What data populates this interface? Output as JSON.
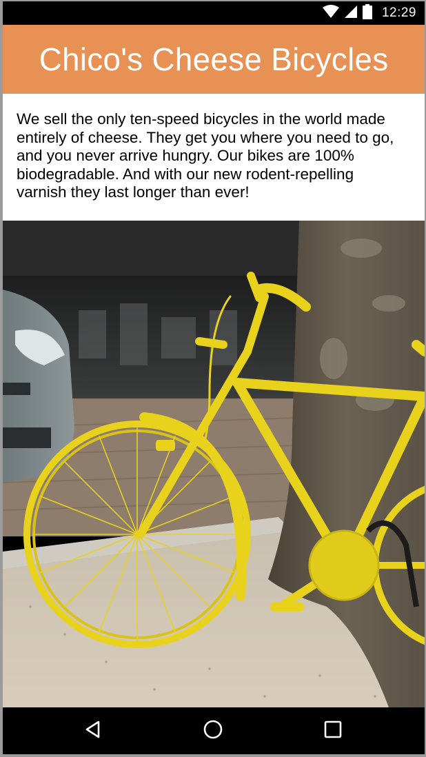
{
  "status_bar": {
    "time": "12:29",
    "icons": [
      "wifi-icon",
      "cell-signal-icon",
      "battery-icon"
    ]
  },
  "header": {
    "title": "Chico's Cheese Bicycles",
    "background_color": "#e89154",
    "text_color": "#ffffff"
  },
  "intro": {
    "text": "We sell the only ten-speed bicycles in the world made entirely of cheese. They get you where you need to go, and you never arrive hungry. Our bikes are 100% biodegradable. And with our new rodent-repelling varnish they last longer than ever!"
  },
  "photo": {
    "subject": "yellow-bicycle-leaning-on-tree",
    "bike_color": "#e8d21c"
  },
  "nav_bar": {
    "buttons": [
      "back-icon",
      "home-icon",
      "recents-icon"
    ]
  }
}
